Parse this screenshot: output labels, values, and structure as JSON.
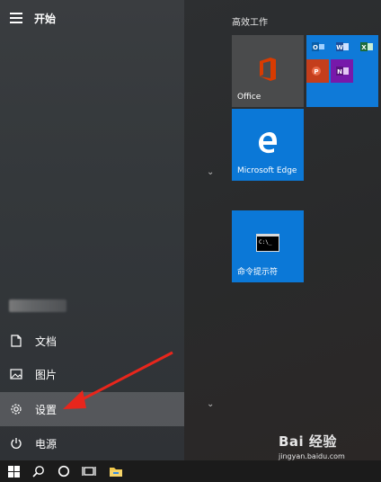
{
  "start": {
    "title": "开始"
  },
  "nav": [
    {
      "id": "documents",
      "label": "文档",
      "icon": "document-icon"
    },
    {
      "id": "pictures",
      "label": "图片",
      "icon": "image-icon"
    },
    {
      "id": "settings",
      "label": "设置",
      "icon": "gear-icon",
      "selected": true
    },
    {
      "id": "power",
      "label": "电源",
      "icon": "power-icon"
    }
  ],
  "tiles": {
    "group_title": "高效工作",
    "office": {
      "label": "Office"
    },
    "folder_minis": [
      "O",
      "W",
      "X",
      "P",
      "N"
    ],
    "edge": {
      "label": "Microsoft Edge"
    },
    "cmd": {
      "label": "命令提示符"
    }
  },
  "taskbar": {
    "items": [
      "windows-start-icon",
      "search-icon",
      "cortana-icon",
      "task-view-icon",
      "file-explorer-icon"
    ]
  },
  "watermark": {
    "logo": "Bai 经验",
    "url": "jingyan.baidu.com"
  },
  "colors": {
    "accent": "#0b78d7",
    "office_red": "#d83b01",
    "taskbar": "#1b1b1b"
  }
}
